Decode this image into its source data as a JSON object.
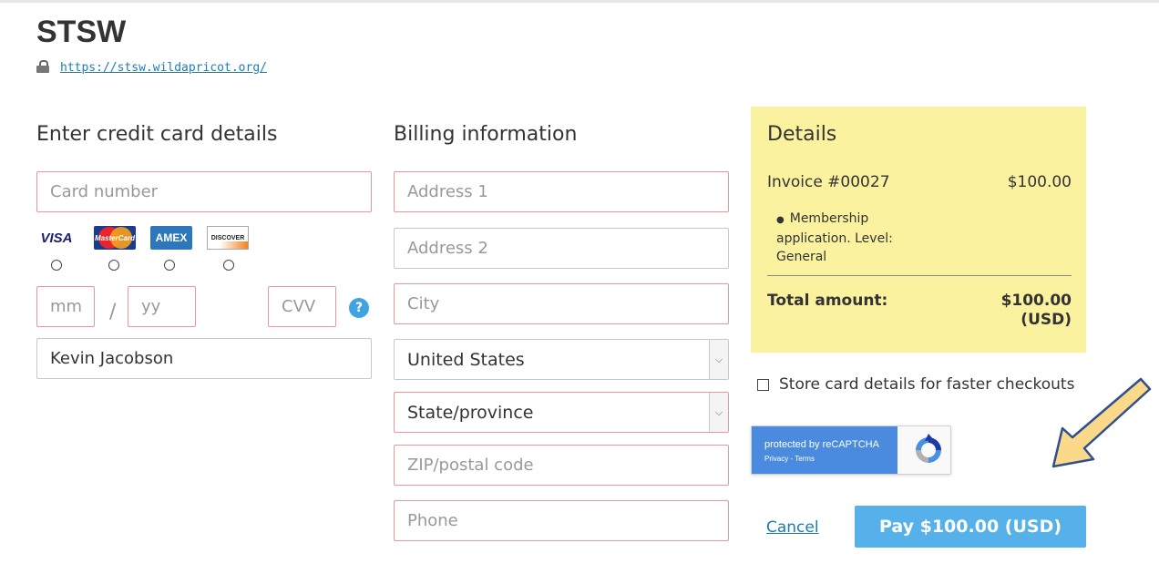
{
  "organization": {
    "name": "STSW",
    "url": "https://stsw.wildapricot.org/"
  },
  "card_section": {
    "heading": "Enter credit card details",
    "card_number_placeholder": "Card number",
    "brands": {
      "visa": "VISA",
      "mastercard": "MasterCard",
      "amex": "AMEX",
      "discover": "DISCOVER"
    },
    "month_placeholder": "mm",
    "separator": "/",
    "year_placeholder": "yy",
    "cvv_placeholder": "CVV",
    "help_symbol": "?",
    "cardholder_name": "Kevin Jacobson"
  },
  "billing_section": {
    "heading": "Billing information",
    "address1_placeholder": "Address 1",
    "address2_placeholder": "Address 2",
    "city_placeholder": "City",
    "country_value": "United States",
    "state_value": "State/province",
    "zip_placeholder": "ZIP/postal code",
    "phone_placeholder": "Phone"
  },
  "details": {
    "heading": "Details",
    "invoice_label": "Invoice #00027",
    "invoice_amount": "$100.00",
    "line_item": "Membership application. Level: General",
    "total_label": "Total amount:",
    "total_amount_line1": "$100.00",
    "total_amount_line2": "(USD)"
  },
  "store_card_label": "Store card details for faster checkouts",
  "recaptcha": {
    "line1": "protected by reCAPTCHA",
    "line2": "Privacy - Terms"
  },
  "actions": {
    "cancel_label": "Cancel",
    "pay_label": "Pay $100.00 (USD)"
  },
  "colors": {
    "invalid_border": "#e29a9a",
    "details_bg": "#fbf29f",
    "pay_button_bg": "#56b1ea",
    "link": "#1e7bb8",
    "arrow_fill": "#fbd98a",
    "arrow_stroke": "#2f4f8f"
  }
}
